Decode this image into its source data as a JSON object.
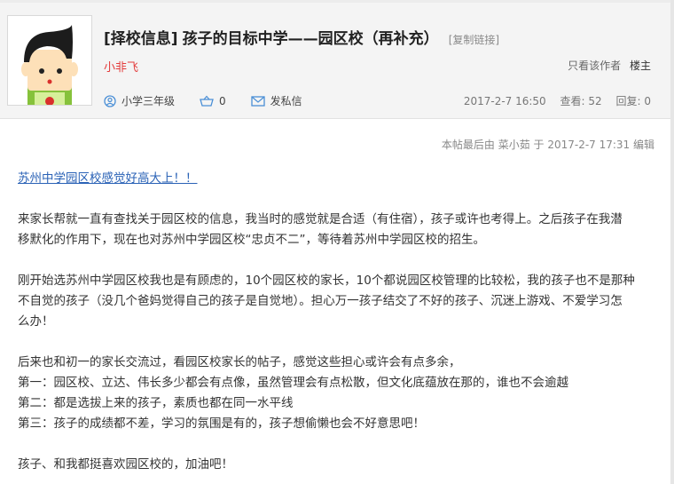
{
  "post": {
    "tag": "[择校信息]",
    "title": "孩子的目标中学——园区校（再补充）",
    "copy_link": "[复制链接]",
    "author": "小非飞",
    "only_author": "只看该作者",
    "owner_label": "楼主",
    "meta": {
      "grade": "小学三年级",
      "likes": "0",
      "message": "发私信",
      "datetime": "2017-2-7 16:50",
      "views": "查看: 52",
      "replies": "回复: 0"
    },
    "edit_note": "本帖最后由 菜小茹 于 2017-2-7 17:31 编辑",
    "link_text": "苏州中学园区校感觉好高大上！！",
    "paragraphs": [
      "来家长帮就一直有查找关于园区校的信息，我当时的感觉就是合适（有住宿），孩子或许也考得上。之后孩子在我潜",
      "移默化的作用下，现在也对苏州中学园区校“忠贞不二”，等待着苏州中学园区校的招生。",
      "刚开始选苏州中学园区校我也是有顾虑的，10个园区校的家长，10个都说园区校管理的比较松，我的孩子也不是那种",
      "不自觉的孩子（没几个爸妈觉得自己的孩子是自觉地）。担心万一孩子结交了不好的孩子、沉迷上游戏、不爱学习怎",
      "么办！",
      "后来也和初一的家长交流过，看园区校家长的帖子，感觉这些担心或许会有点多余，",
      "第一：园区校、立达、伟长多少都会有点像，虽然管理会有点松散，但文化底蕴放在那的，谁也不会逾越",
      "第二：都是选拔上来的孩子，素质也都在同一水平线",
      "第三：孩子的成绩都不差，学习的氛围是有的，孩子想偷懒也会不好意思吧！",
      "孩子、和我都挺喜欢园区校的，加油吧！"
    ]
  },
  "icons": {
    "avatar": "cartoon-kid-avatar",
    "grade": "user-circle-icon",
    "likes": "basket-icon",
    "message": "envelope-icon"
  },
  "colors": {
    "header_bg": "#f4f4f4",
    "author": "#e33c3c",
    "link": "#2a62b6",
    "icon": "#4a8fd6"
  }
}
